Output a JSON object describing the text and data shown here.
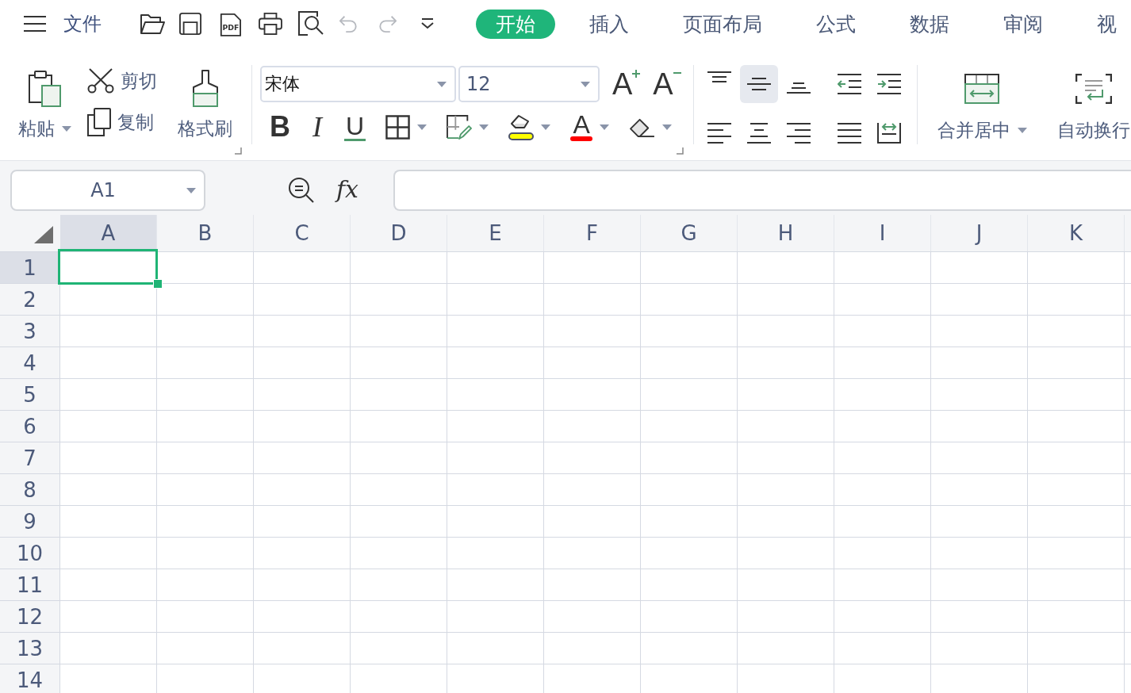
{
  "top_bar": {
    "menu_label": "文件",
    "quick_access": [
      {
        "kind": "open",
        "disabled": false
      },
      {
        "kind": "save",
        "disabled": false
      },
      {
        "kind": "pdf",
        "text": "PDF",
        "disabled": false
      },
      {
        "kind": "print",
        "disabled": false
      },
      {
        "kind": "preview",
        "disabled": false
      },
      {
        "kind": "undo",
        "disabled": true
      },
      {
        "kind": "redo",
        "disabled": true
      },
      {
        "kind": "more",
        "disabled": false
      }
    ]
  },
  "tabs": [
    {
      "label": "开始",
      "selected": true
    },
    {
      "label": "插入",
      "selected": false
    },
    {
      "label": "页面布局",
      "selected": false
    },
    {
      "label": "公式",
      "selected": false
    },
    {
      "label": "数据",
      "selected": false
    },
    {
      "label": "审阅",
      "selected": false
    },
    {
      "label": "视",
      "selected": false
    }
  ],
  "ribbon": {
    "clipboard": {
      "paste": {
        "label": "粘贴",
        "dropdown": true
      },
      "cut": "剪切",
      "copy": "复制",
      "format_painter": "格式刷"
    },
    "font": {
      "name": "宋体",
      "size": "12",
      "size_buttons": [
        {
          "kind": "grow",
          "glyph": "A"
        },
        {
          "kind": "shrink",
          "glyph": "A"
        }
      ],
      "format_buttons": [
        {
          "kind": "bold",
          "glyph": "B",
          "dropdown": false
        },
        {
          "kind": "italic",
          "glyph": "I",
          "dropdown": false
        },
        {
          "kind": "underline",
          "glyph": "U",
          "dropdown": false
        },
        {
          "kind": "borders",
          "dropdown": true
        },
        {
          "kind": "cell_style",
          "dropdown": true
        },
        {
          "kind": "fill_color",
          "color": "#ffff00",
          "dropdown": true
        },
        {
          "kind": "font_color",
          "glyph": "A",
          "color": "#ff0000",
          "dropdown": true
        },
        {
          "kind": "clear",
          "dropdown": true
        }
      ]
    },
    "alignment": [
      {
        "kind": "top",
        "selected": false
      },
      {
        "kind": "middle",
        "selected": true
      },
      {
        "kind": "bottom",
        "selected": false
      },
      {
        "kind": "indent_decrease",
        "selected": false
      },
      {
        "kind": "indent_increase",
        "selected": false
      },
      {
        "kind": "left",
        "selected": false
      },
      {
        "kind": "center",
        "selected": false
      },
      {
        "kind": "right",
        "selected": false
      },
      {
        "kind": "justify",
        "selected": false
      },
      {
        "kind": "distributed",
        "selected": false
      }
    ],
    "merge": {
      "label": "合并居中",
      "dropdown": true
    },
    "wrap": {
      "label": "自动换行"
    }
  },
  "formula_bar": {
    "name_box": "A1",
    "function_label": "fx"
  },
  "sheet": {
    "columns": [
      {
        "label": "A",
        "selected": true
      },
      {
        "label": "B",
        "selected": false
      },
      {
        "label": "C",
        "selected": false
      },
      {
        "label": "D",
        "selected": false
      },
      {
        "label": "E",
        "selected": false
      },
      {
        "label": "F",
        "selected": false
      },
      {
        "label": "G",
        "selected": false
      },
      {
        "label": "H",
        "selected": false
      },
      {
        "label": "I",
        "selected": false
      },
      {
        "label": "J",
        "selected": false
      },
      {
        "label": "K",
        "selected": false
      }
    ],
    "rows": [
      {
        "label": "1",
        "selected": true
      },
      {
        "label": "2",
        "selected": false
      },
      {
        "label": "3",
        "selected": false
      },
      {
        "label": "4",
        "selected": false
      },
      {
        "label": "5",
        "selected": false
      },
      {
        "label": "6",
        "selected": false
      },
      {
        "label": "7",
        "selected": false
      },
      {
        "label": "8",
        "selected": false
      },
      {
        "label": "9",
        "selected": false
      },
      {
        "label": "10",
        "selected": false
      },
      {
        "label": "11",
        "selected": false
      },
      {
        "label": "12",
        "selected": false
      },
      {
        "label": "13",
        "selected": false
      },
      {
        "label": "14",
        "selected": false
      }
    ]
  }
}
